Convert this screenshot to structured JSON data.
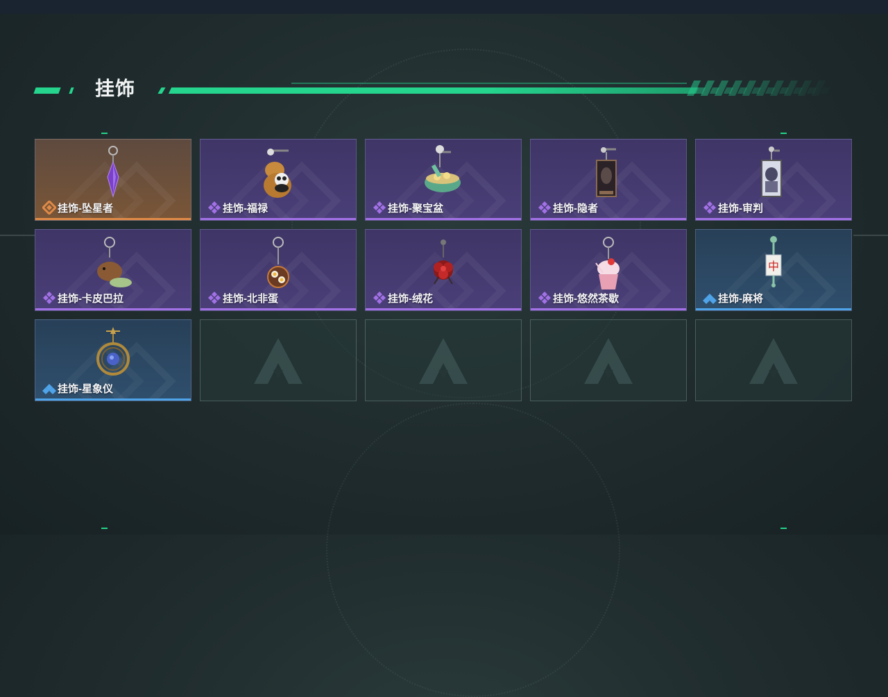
{
  "section": {
    "title": "挂饰"
  },
  "colors": {
    "accent": "#25d58e",
    "epic": "#a271e6",
    "legendary": "#e08a47",
    "rare": "#4fa3e8"
  },
  "items": [
    {
      "label": "挂饰-坠星者",
      "rarity": "legendary",
      "icon": "purple-crystal-charm"
    },
    {
      "label": "挂饰-福禄",
      "rarity": "epic",
      "icon": "panda-gourd-charm"
    },
    {
      "label": "挂饰-聚宝盆",
      "rarity": "epic",
      "icon": "treasure-bowl-charm"
    },
    {
      "label": "挂饰-隐者",
      "rarity": "epic",
      "icon": "hermit-card-charm"
    },
    {
      "label": "挂饰-审判",
      "rarity": "epic",
      "icon": "judgement-card-charm"
    },
    {
      "label": "挂饰-卡皮巴拉",
      "rarity": "epic",
      "icon": "capybara-charm"
    },
    {
      "label": "挂饰-北非蛋",
      "rarity": "epic",
      "icon": "shakshuka-charm"
    },
    {
      "label": "挂饰-绒花",
      "rarity": "epic",
      "icon": "red-flower-charm"
    },
    {
      "label": "挂饰-悠然茶歇",
      "rarity": "epic",
      "icon": "cupcake-charm"
    },
    {
      "label": "挂饰-麻将",
      "rarity": "rare",
      "icon": "mahjong-tile-charm"
    },
    {
      "label": "挂饰-星象仪",
      "rarity": "rare",
      "icon": "orrery-charm"
    }
  ],
  "empty_slots": 4
}
